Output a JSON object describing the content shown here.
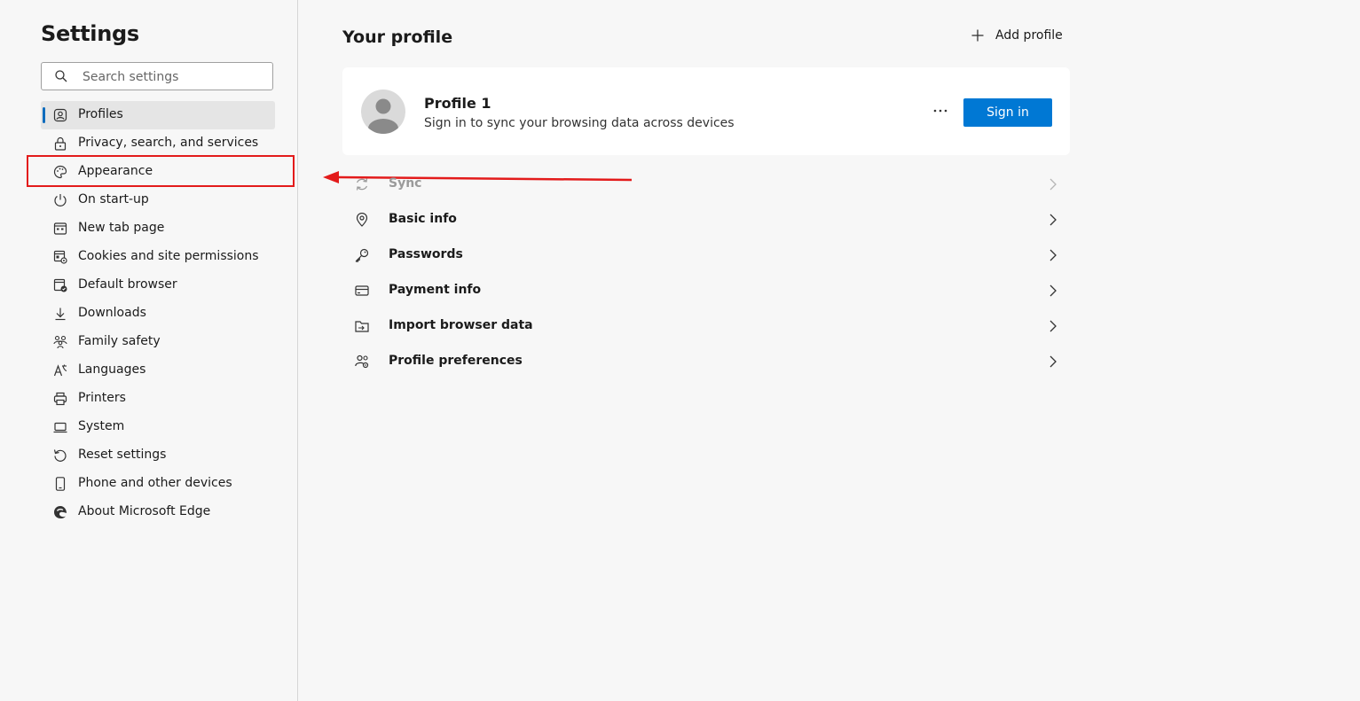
{
  "sidebar": {
    "title": "Settings",
    "search_placeholder": "Search settings",
    "items": [
      {
        "label": "Profiles",
        "icon": "profile-icon"
      },
      {
        "label": "Privacy, search, and services",
        "icon": "lock-icon"
      },
      {
        "label": "Appearance",
        "icon": "palette-icon"
      },
      {
        "label": "On start-up",
        "icon": "power-icon"
      },
      {
        "label": "New tab page",
        "icon": "new-tab-icon"
      },
      {
        "label": "Cookies and site permissions",
        "icon": "cookies-icon"
      },
      {
        "label": "Default browser",
        "icon": "default-browser-icon"
      },
      {
        "label": "Downloads",
        "icon": "download-icon"
      },
      {
        "label": "Family safety",
        "icon": "family-icon"
      },
      {
        "label": "Languages",
        "icon": "languages-icon"
      },
      {
        "label": "Printers",
        "icon": "printer-icon"
      },
      {
        "label": "System",
        "icon": "system-icon"
      },
      {
        "label": "Reset settings",
        "icon": "reset-icon"
      },
      {
        "label": "Phone and other devices",
        "icon": "phone-icon"
      },
      {
        "label": "About Microsoft Edge",
        "icon": "edge-logo-icon"
      }
    ],
    "active_index": 0
  },
  "main": {
    "title": "Your profile",
    "add_profile_label": "Add profile",
    "profile": {
      "name": "Profile 1",
      "description": "Sign in to sync your browsing data across devices",
      "more_label": "···",
      "sign_in_label": "Sign in"
    },
    "list": [
      {
        "label": "Sync",
        "icon": "sync-icon",
        "disabled": true
      },
      {
        "label": "Basic info",
        "icon": "location-pin-icon",
        "disabled": false
      },
      {
        "label": "Passwords",
        "icon": "key-icon",
        "disabled": false
      },
      {
        "label": "Payment info",
        "icon": "credit-card-icon",
        "disabled": false
      },
      {
        "label": "Import browser data",
        "icon": "import-icon",
        "disabled": false
      },
      {
        "label": "Profile preferences",
        "icon": "profile-settings-icon",
        "disabled": false
      }
    ]
  },
  "annotation": {
    "color": "#e31b1b"
  },
  "colors": {
    "accent": "#0078d4",
    "active_indicator": "#0f6cbd"
  }
}
